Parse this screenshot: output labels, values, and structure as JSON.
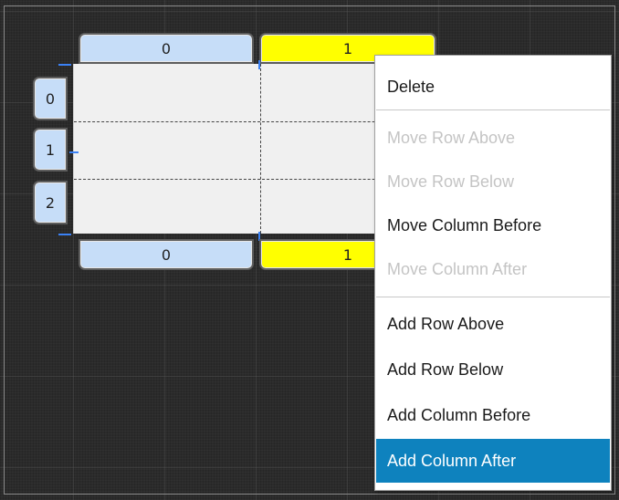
{
  "columns": {
    "top": [
      {
        "label": "0"
      },
      {
        "label": "1"
      }
    ],
    "bottom": [
      {
        "label": "0"
      },
      {
        "label": "1"
      }
    ]
  },
  "rows": [
    {
      "label": "0"
    },
    {
      "label": "1"
    },
    {
      "label": "2"
    }
  ],
  "selection": {
    "column_index": 1,
    "highlight_color": "#ffff00"
  },
  "context_menu": {
    "items": [
      {
        "label": "Delete",
        "enabled": true
      },
      {
        "label": "Move Row Above",
        "enabled": false
      },
      {
        "label": "Move Row Below",
        "enabled": false
      },
      {
        "label": "Move Column Before",
        "enabled": true
      },
      {
        "label": "Move Column After",
        "enabled": false
      },
      {
        "label": "Add Row Above",
        "enabled": true
      },
      {
        "label": "Add Row Below",
        "enabled": true
      },
      {
        "label": "Add Column Before",
        "enabled": true
      },
      {
        "label": "Add Column After",
        "enabled": true,
        "highlighted": true
      }
    ],
    "highlight_color": "#0e82be"
  },
  "colors": {
    "header_fill": "#c6ddf8",
    "cell_fill": "#f0f0f0",
    "canvas_background": "#2b2b2b"
  }
}
